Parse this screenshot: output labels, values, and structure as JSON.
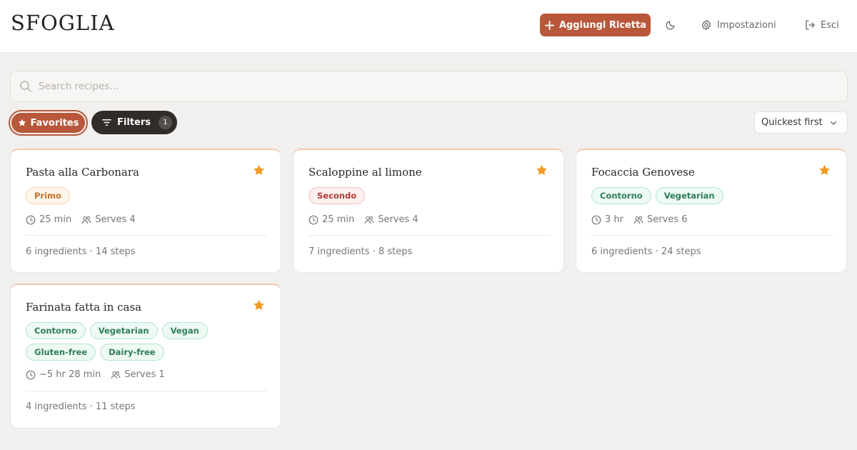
{
  "header": {
    "logo": "SFOGLIA",
    "add_recipe_label": "Aggiungi Ricetta",
    "settings_label": "Impostazioni",
    "logout_label": "Esci"
  },
  "search": {
    "placeholder": "Search recipes...",
    "value": ""
  },
  "toolbar": {
    "favorites_label": "Favorites",
    "filters_label": "Filters",
    "filters_count": "1",
    "sort_value": "Quickest first"
  },
  "colors": {
    "accent": "#b9573a",
    "dark": "#2f2c2a",
    "star": "#f29a21",
    "tag_green": "#2f7d5a"
  },
  "recipes": [
    {
      "title": "Pasta alla Carbonara",
      "favorite": true,
      "tags": [
        {
          "label": "Primo",
          "kind": "primo"
        }
      ],
      "time": "25 min",
      "serves": "Serves 4",
      "summary": "6 ingredients · 14 steps"
    },
    {
      "title": "Scaloppine al limone",
      "favorite": true,
      "tags": [
        {
          "label": "Secondo",
          "kind": "secondo"
        }
      ],
      "time": "25 min",
      "serves": "Serves 4",
      "summary": "7 ingredients · 8 steps"
    },
    {
      "title": "Focaccia Genovese",
      "favorite": true,
      "tags": [
        {
          "label": "Contorno",
          "kind": "green"
        },
        {
          "label": "Vegetarian",
          "kind": "green"
        }
      ],
      "time": "3 hr",
      "serves": "Serves 6",
      "summary": "6 ingredients · 24 steps"
    },
    {
      "title": "Farinata fatta in casa",
      "favorite": true,
      "tags": [
        {
          "label": "Contorno",
          "kind": "green"
        },
        {
          "label": "Vegetarian",
          "kind": "green"
        },
        {
          "label": "Vegan",
          "kind": "green"
        },
        {
          "label": "Gluten-free",
          "kind": "green"
        },
        {
          "label": "Dairy-free",
          "kind": "green"
        }
      ],
      "time": "~5 hr 28 min",
      "serves": "Serves 1",
      "summary": "4 ingredients · 11 steps"
    }
  ]
}
